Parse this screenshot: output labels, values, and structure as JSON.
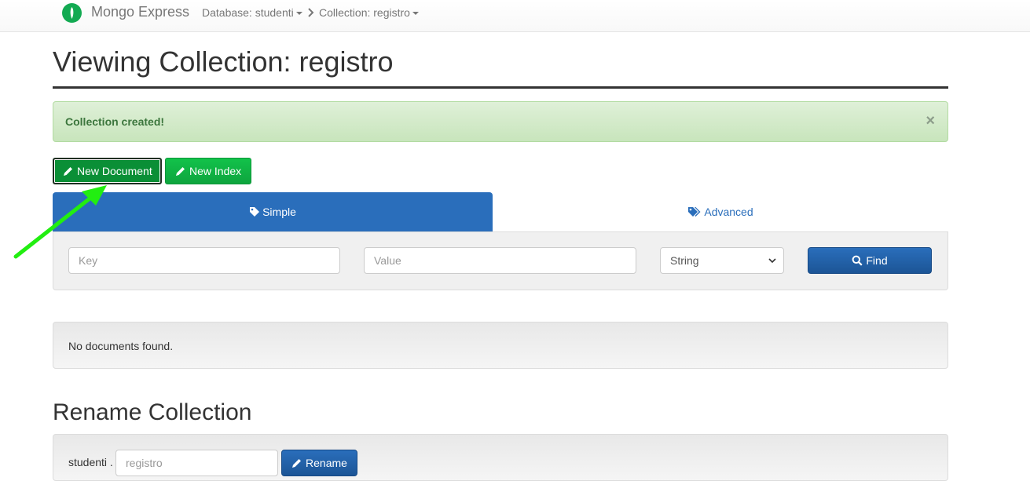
{
  "navbar": {
    "brand": "Mongo Express",
    "database": "Database: studenti",
    "collection": "Collection: registro",
    "icons": {
      "logo": "mongodb-leaf-icon",
      "separator": "chevron-right-icon"
    }
  },
  "page": {
    "title": "Viewing Collection: registro"
  },
  "alert": {
    "message": "Collection created!",
    "close": "×"
  },
  "actions": {
    "new_document": "New Document",
    "new_index": "New Index"
  },
  "tabs": {
    "simple": "Simple",
    "advanced": "Advanced"
  },
  "search": {
    "key_placeholder": "Key",
    "value_placeholder": "Value",
    "type_selected": "String",
    "find_label": "Find"
  },
  "documents": {
    "empty_message": "No documents found."
  },
  "rename": {
    "title": "Rename Collection",
    "prefix": "studenti .",
    "input_placeholder": "registro",
    "button_label": "Rename"
  },
  "colors": {
    "accent_blue": "#2a6ebb",
    "success_green": "#12c24a",
    "annotation_arrow": "#22ee11"
  }
}
